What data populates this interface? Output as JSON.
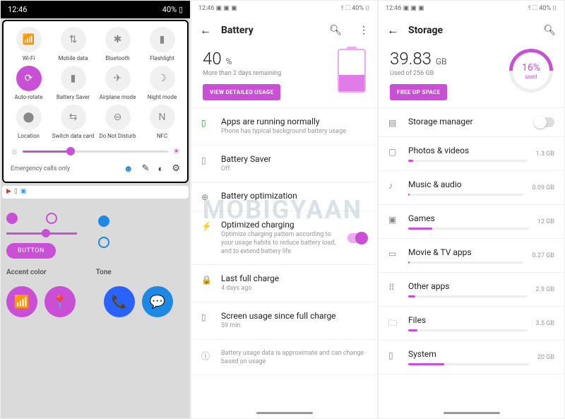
{
  "panel1": {
    "status": {
      "time": "12:46",
      "battery": "40% ▯"
    },
    "tiles": [
      {
        "label": "Wi-Fi",
        "glyph": "📶",
        "active": false
      },
      {
        "label": "Mobile data",
        "glyph": "⇅",
        "active": false
      },
      {
        "label": "Bluetooth",
        "glyph": "✱",
        "active": false
      },
      {
        "label": "Flashlight",
        "glyph": "▮",
        "active": false
      },
      {
        "label": "Auto-rotate",
        "glyph": "⟳",
        "active": true
      },
      {
        "label": "Battery Saver",
        "glyph": "▮",
        "active": false
      },
      {
        "label": "Airplane mode",
        "glyph": "✈",
        "active": false
      },
      {
        "label": "Night mode",
        "glyph": "☽",
        "active": false
      },
      {
        "label": "Location",
        "glyph": "⬤",
        "active": false
      },
      {
        "label": "Switch data card",
        "glyph": "⇆",
        "active": false
      },
      {
        "label": "Do Not Disturb",
        "glyph": "⊖",
        "active": false
      },
      {
        "label": "NFC",
        "glyph": "N",
        "active": false
      }
    ],
    "emergency": "Emergency calls only",
    "theme": {
      "button": "BUTTON",
      "label1": "Accent color",
      "label2": "Tone"
    }
  },
  "panel2": {
    "status": {
      "time": "12:46 ▣ ▣ ▣",
      "right": "⫯ ⬚ 40% ▯"
    },
    "title": "Battery",
    "stat": {
      "value": "40",
      "unit": "%",
      "sub": "More than 2 days remaining",
      "button": "VIEW DETAILED USAGE"
    },
    "items": [
      {
        "icon": "▯",
        "iconClass": "grn",
        "title": "Apps are running normally",
        "sub": "Phone has typical background battery usage"
      },
      {
        "icon": "▯",
        "title": "Battery Saver",
        "sub": "Off"
      },
      {
        "icon": "⊕",
        "title": "Battery optimization",
        "sub": ""
      },
      {
        "icon": "⚡",
        "title": "Optimized charging",
        "sub": "Optimize charging pattern according to your usage habits to reduce battery load, and to extend battery life",
        "toggle": true
      },
      {
        "icon": "🔒",
        "title": "Last full charge",
        "sub": "4 days ago"
      },
      {
        "icon": "▯",
        "title": "Screen usage since full charge",
        "sub": "59 min"
      },
      {
        "icon": "ⓘ",
        "title": "",
        "sub": "Battery usage data is approximate and can change based on usage"
      }
    ]
  },
  "panel3": {
    "status": {
      "time": "12:46 ▣ ▣ ▣",
      "right": "⫯ ⬚ 40% ▯"
    },
    "title": "Storage",
    "stat": {
      "value": "39.83",
      "unit": "GB",
      "sub": "Used of 256 GB",
      "button": "FREE UP SPACE",
      "ring": "16%",
      "ring_sub": "used"
    },
    "items": [
      {
        "icon": "▤",
        "title": "Storage manager",
        "toggleOff": true
      },
      {
        "icon": "▢",
        "title": "Photos & videos",
        "right": "1.3 GB",
        "bar": 4
      },
      {
        "icon": "♪",
        "title": "Music & audio",
        "right": "0.09 GB",
        "bar": 1
      },
      {
        "icon": "▣",
        "title": "Games",
        "right": "12 GB",
        "bar": 20
      },
      {
        "icon": "▭",
        "title": "Movie & TV apps",
        "right": "0.27 GB",
        "bar": 1
      },
      {
        "icon": "⠿",
        "title": "Other apps",
        "right": "2.9 GB",
        "bar": 6
      },
      {
        "icon": "🗀",
        "title": "Files",
        "right": "3.5 GB",
        "bar": 8
      },
      {
        "icon": "▯",
        "title": "System",
        "right": "20 GB",
        "bar": 30
      }
    ]
  },
  "watermark": "MOBIGYAAN"
}
